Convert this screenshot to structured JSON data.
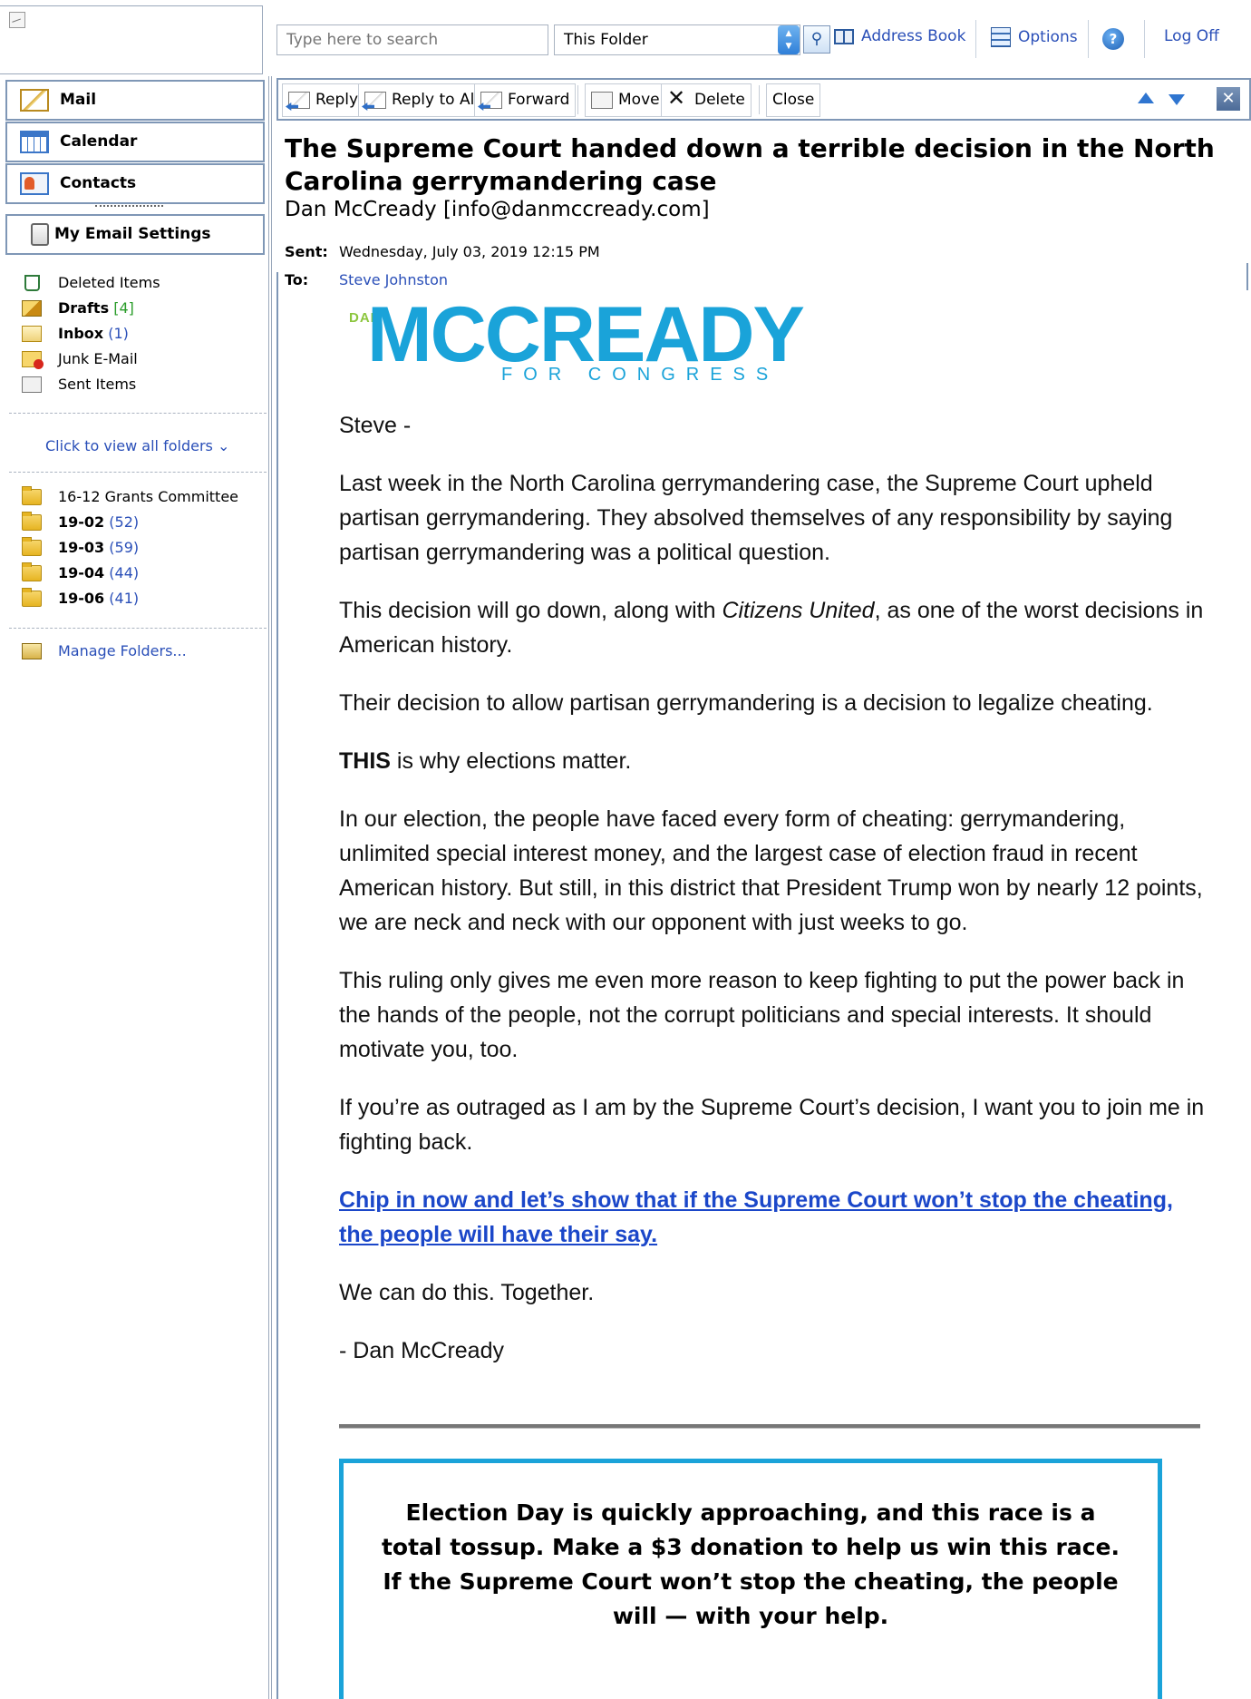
{
  "header": {
    "search_placeholder": "Type here to search",
    "scope_value": "This Folder",
    "address_book": "Address Book",
    "options": "Options",
    "log_off": "Log Off"
  },
  "nav": {
    "mail": "Mail",
    "calendar": "Calendar",
    "contacts": "Contacts",
    "settings": "My Email Settings"
  },
  "folders": [
    {
      "name": "Deleted Items",
      "count": "",
      "bold": false,
      "icon": "deleted-items-icon"
    },
    {
      "name": "Drafts",
      "count": "[4]",
      "bold": true,
      "icon": "drafts-icon"
    },
    {
      "name": "Inbox",
      "count": "(1)",
      "bold": true,
      "icon": "inbox-icon"
    },
    {
      "name": "Junk E-Mail",
      "count": "",
      "bold": false,
      "icon": "junk-mail-icon"
    },
    {
      "name": "Sent Items",
      "count": "",
      "bold": false,
      "icon": "sent-items-icon"
    }
  ],
  "view_all_label": "Click to view all folders",
  "custom_folders": [
    {
      "name": "16-12 Grants Committee",
      "count": "",
      "bold": false
    },
    {
      "name": "19-02",
      "count": "(52)",
      "bold": true
    },
    {
      "name": "19-03",
      "count": "(59)",
      "bold": true
    },
    {
      "name": "19-04",
      "count": "(44)",
      "bold": true
    },
    {
      "name": "19-06",
      "count": "(41)",
      "bold": true
    }
  ],
  "manage_folders": "Manage Folders...",
  "toolbar": {
    "reply": "Reply",
    "reply_all": "Reply to All",
    "forward": "Forward",
    "move": "Move",
    "delete": "Delete",
    "close": "Close"
  },
  "message": {
    "subject": "The Supreme Court handed down a terrible decision in the North Carolina gerrymandering case",
    "from": "Dan McCready [info@danmccready.com]",
    "sent_label": "Sent:",
    "sent_value": "Wednesday, July 03, 2019 12:15 PM",
    "to_label": "To:",
    "to_value": "Steve Johnston"
  },
  "brand": {
    "first": "DAN",
    "last": "MCCREADY",
    "tagline": "FOR CONGRESS",
    "colors": {
      "blue": "#1aa3d9",
      "green": "#8cc63e"
    }
  },
  "body": {
    "greeting": "Steve -",
    "p1": "Last week in the North Carolina gerrymandering case, the Supreme Court upheld partisan gerrymandering. They absolved themselves of any responsibility by saying partisan gerrymandering was a political question.",
    "p2_before": "This decision will go down, along with ",
    "p2_italic": "Citizens United",
    "p2_after": ", as one of the worst decisions in American history.",
    "p3": "Their decision to allow partisan gerrymandering is a decision to legalize cheating.",
    "p4_bold": "THIS",
    "p4_rest": " is why elections matter.",
    "p5": "In our election, the people have faced every form of cheating: gerrymandering, unlimited special interest money, and the largest case of election fraud in recent American history. But still, in this district that President Trump won by nearly 12 points, we are neck and neck with our opponent with just weeks to go.",
    "p6": "This ruling only gives me even more reason to keep fighting to put the power back in the hands of the people, not the corrupt politicians and special interests. It should motivate you, too.",
    "p7": "If you’re as outraged as I am by the Supreme Court’s decision, I want you to join me in fighting back.",
    "link": "Chip in now and let’s show that if the Supreme Court won’t stop the cheating, the people will have their say.",
    "p8": "We can do this. Together.",
    "signature": "- Dan McCready",
    "cta": "Election Day is quickly approaching, and this race is a total tossup. Make a $3 donation to help us win this race. If the Supreme Court won’t stop the cheating, the people will — with your help."
  }
}
